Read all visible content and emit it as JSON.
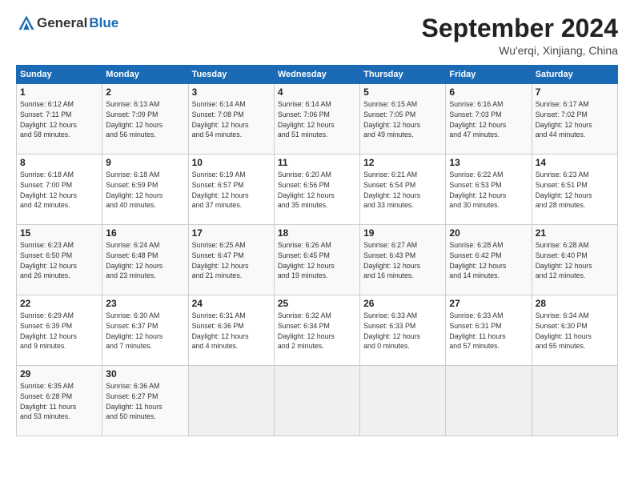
{
  "header": {
    "logo_general": "General",
    "logo_blue": "Blue",
    "month_title": "September 2024",
    "location": "Wu'erqi, Xinjiang, China"
  },
  "days_of_week": [
    "Sunday",
    "Monday",
    "Tuesday",
    "Wednesday",
    "Thursday",
    "Friday",
    "Saturday"
  ],
  "weeks": [
    [
      {
        "day": "1",
        "content": "Sunrise: 6:12 AM\nSunset: 7:11 PM\nDaylight: 12 hours\nand 58 minutes."
      },
      {
        "day": "2",
        "content": "Sunrise: 6:13 AM\nSunset: 7:09 PM\nDaylight: 12 hours\nand 56 minutes."
      },
      {
        "day": "3",
        "content": "Sunrise: 6:14 AM\nSunset: 7:08 PM\nDaylight: 12 hours\nand 54 minutes."
      },
      {
        "day": "4",
        "content": "Sunrise: 6:14 AM\nSunset: 7:06 PM\nDaylight: 12 hours\nand 51 minutes."
      },
      {
        "day": "5",
        "content": "Sunrise: 6:15 AM\nSunset: 7:05 PM\nDaylight: 12 hours\nand 49 minutes."
      },
      {
        "day": "6",
        "content": "Sunrise: 6:16 AM\nSunset: 7:03 PM\nDaylight: 12 hours\nand 47 minutes."
      },
      {
        "day": "7",
        "content": "Sunrise: 6:17 AM\nSunset: 7:02 PM\nDaylight: 12 hours\nand 44 minutes."
      }
    ],
    [
      {
        "day": "8",
        "content": "Sunrise: 6:18 AM\nSunset: 7:00 PM\nDaylight: 12 hours\nand 42 minutes."
      },
      {
        "day": "9",
        "content": "Sunrise: 6:18 AM\nSunset: 6:59 PM\nDaylight: 12 hours\nand 40 minutes."
      },
      {
        "day": "10",
        "content": "Sunrise: 6:19 AM\nSunset: 6:57 PM\nDaylight: 12 hours\nand 37 minutes."
      },
      {
        "day": "11",
        "content": "Sunrise: 6:20 AM\nSunset: 6:56 PM\nDaylight: 12 hours\nand 35 minutes."
      },
      {
        "day": "12",
        "content": "Sunrise: 6:21 AM\nSunset: 6:54 PM\nDaylight: 12 hours\nand 33 minutes."
      },
      {
        "day": "13",
        "content": "Sunrise: 6:22 AM\nSunset: 6:53 PM\nDaylight: 12 hours\nand 30 minutes."
      },
      {
        "day": "14",
        "content": "Sunrise: 6:23 AM\nSunset: 6:51 PM\nDaylight: 12 hours\nand 28 minutes."
      }
    ],
    [
      {
        "day": "15",
        "content": "Sunrise: 6:23 AM\nSunset: 6:50 PM\nDaylight: 12 hours\nand 26 minutes."
      },
      {
        "day": "16",
        "content": "Sunrise: 6:24 AM\nSunset: 6:48 PM\nDaylight: 12 hours\nand 23 minutes."
      },
      {
        "day": "17",
        "content": "Sunrise: 6:25 AM\nSunset: 6:47 PM\nDaylight: 12 hours\nand 21 minutes."
      },
      {
        "day": "18",
        "content": "Sunrise: 6:26 AM\nSunset: 6:45 PM\nDaylight: 12 hours\nand 19 minutes."
      },
      {
        "day": "19",
        "content": "Sunrise: 6:27 AM\nSunset: 6:43 PM\nDaylight: 12 hours\nand 16 minutes."
      },
      {
        "day": "20",
        "content": "Sunrise: 6:28 AM\nSunset: 6:42 PM\nDaylight: 12 hours\nand 14 minutes."
      },
      {
        "day": "21",
        "content": "Sunrise: 6:28 AM\nSunset: 6:40 PM\nDaylight: 12 hours\nand 12 minutes."
      }
    ],
    [
      {
        "day": "22",
        "content": "Sunrise: 6:29 AM\nSunset: 6:39 PM\nDaylight: 12 hours\nand 9 minutes."
      },
      {
        "day": "23",
        "content": "Sunrise: 6:30 AM\nSunset: 6:37 PM\nDaylight: 12 hours\nand 7 minutes."
      },
      {
        "day": "24",
        "content": "Sunrise: 6:31 AM\nSunset: 6:36 PM\nDaylight: 12 hours\nand 4 minutes."
      },
      {
        "day": "25",
        "content": "Sunrise: 6:32 AM\nSunset: 6:34 PM\nDaylight: 12 hours\nand 2 minutes."
      },
      {
        "day": "26",
        "content": "Sunrise: 6:33 AM\nSunset: 6:33 PM\nDaylight: 12 hours\nand 0 minutes."
      },
      {
        "day": "27",
        "content": "Sunrise: 6:33 AM\nSunset: 6:31 PM\nDaylight: 11 hours\nand 57 minutes."
      },
      {
        "day": "28",
        "content": "Sunrise: 6:34 AM\nSunset: 6:30 PM\nDaylight: 11 hours\nand 55 minutes."
      }
    ],
    [
      {
        "day": "29",
        "content": "Sunrise: 6:35 AM\nSunset: 6:28 PM\nDaylight: 11 hours\nand 53 minutes."
      },
      {
        "day": "30",
        "content": "Sunrise: 6:36 AM\nSunset: 6:27 PM\nDaylight: 11 hours\nand 50 minutes."
      },
      {
        "day": "",
        "content": ""
      },
      {
        "day": "",
        "content": ""
      },
      {
        "day": "",
        "content": ""
      },
      {
        "day": "",
        "content": ""
      },
      {
        "day": "",
        "content": ""
      }
    ]
  ]
}
